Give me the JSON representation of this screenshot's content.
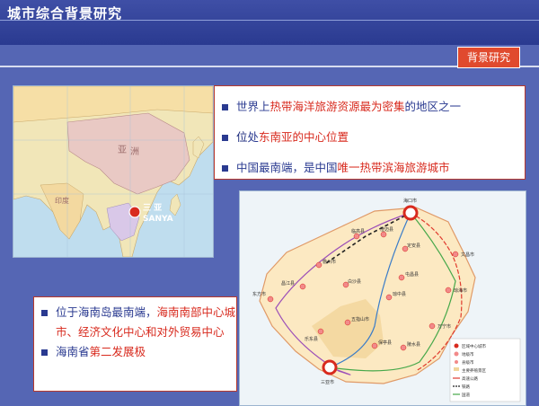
{
  "slide": {
    "title": "城市综合背景研究",
    "badge": "背景研究",
    "colors": {
      "background": "#5566B4",
      "accent": "#E04A2E",
      "text": "#2A3A90",
      "highlight": "#D82A1E"
    }
  },
  "asia_map": {
    "label_cn": "三 亚",
    "label_en": "SANYA",
    "region_labels": [
      "亚",
      "洲",
      "印",
      "度"
    ]
  },
  "facts_top": [
    {
      "pre": "世界上",
      "hl": "热带海洋旅游资源最为密集",
      "post": "的地区之一"
    },
    {
      "pre": "位",
      "mid": "处",
      "hl": "东南亚的中心位置",
      "post": ""
    },
    {
      "pre": "中国最南端，是中国",
      "hl": "唯一热带滨海旅游城市",
      "post": ""
    }
  ],
  "facts_bottom": [
    {
      "pre": "位于海南岛最南端，",
      "hl": "海南南部中心城市、经济文化中心和对外贸易中心",
      "post": ""
    },
    {
      "pre": "海南省",
      "hl": "第二发展极",
      "post": ""
    }
  ],
  "island_map": {
    "cities": [
      "海口市",
      "三亚市",
      "文昌市",
      "琼海市",
      "万宁市",
      "东方市",
      "儋州市",
      "临高县",
      "澄迈县",
      "定安县",
      "屯昌县",
      "琼中县",
      "五指山市",
      "陵水县",
      "乐东县",
      "保亭县",
      "白沙县",
      "昌江县"
    ],
    "legend": [
      "区域中心城市",
      "地级市",
      "县级市",
      "主要养殖景区",
      "高速公路",
      "铁路",
      "国道"
    ]
  }
}
